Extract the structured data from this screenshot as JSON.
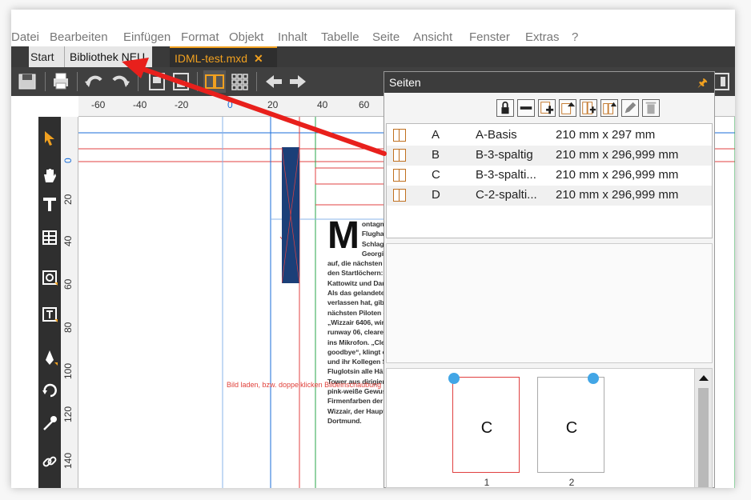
{
  "menu": [
    "Datei",
    "Bearbeiten",
    "Einfügen",
    "Format",
    "Objekt",
    "Inhalt",
    "Tabelle",
    "Seite",
    "Ansicht",
    "Fenster",
    "Extras",
    "?"
  ],
  "tabs": {
    "start": "Start",
    "bibliothek": "Bibliothek NEU",
    "idml": "IDML-test.mxd",
    "close_glyph": "✕"
  },
  "ruler_h": [
    "-60",
    "-40",
    "-20",
    "0",
    "20",
    "40",
    "60"
  ],
  "ruler_v": [
    "0",
    "20",
    "40",
    "60",
    "80",
    "100",
    "120",
    "140"
  ],
  "seiten": {
    "title": "Seiten",
    "masters": [
      {
        "letter": "A",
        "name": "A-Basis",
        "size": "210 mm x 297 mm"
      },
      {
        "letter": "B",
        "name": "B-3-spaltig",
        "size": "210 mm x 296,999 mm"
      },
      {
        "letter": "C",
        "name": "B-3-spalti...",
        "size": "210 mm x 296,999 mm"
      },
      {
        "letter": "D",
        "name": "C-2-spalti...",
        "size": "210 mm x 296,999 mm"
      }
    ],
    "pages": [
      {
        "master": "C",
        "number": "1"
      },
      {
        "master": "C",
        "number": "2"
      }
    ]
  },
  "article": {
    "drop_cap": "M",
    "text": "ontagmorgen, am Dortmunder Flughafen geht es Schlag auf Schlag: Ein Airbus aus Georgien setzt auf der Piste auf, die nächsten Flieger stehen bereits in den Startlöchern: Vier A320 mit den Zielen Kattowitz und Danzig, Kiew und Budapest. Als das gelandete Flugzeug die Piste verlassen hat, gibt Laura Wolf den nächsten Piloten die Startfreigabe: „Wizzair 6406, wind 090 degrees 5 knots, runway 06, cleared for takeoff“, sagt sie ins Mikrofon. „Cleared for take-off, goodbye“, klingt es zurück. Laura Wolf und ihr Kollegen Stefan Stahl hat die Fluglotsin alle Hände voll zu tun: Vom Tower aus dirigieren die beiden das lila-pink-weiße Gewusel unter ihnen – die Firmenfarben der Fluggesellschaft Wizzair, der Hauptkunde am Flughafen Dortmund."
  },
  "caption": "Bild laden, bzw. doppelklicken Bildeinschaubung",
  "colors": {
    "accent": "#f0a020",
    "arrow": "#e8201c",
    "blue_block": "#1b3f78",
    "page_dot": "#42a6e6"
  }
}
